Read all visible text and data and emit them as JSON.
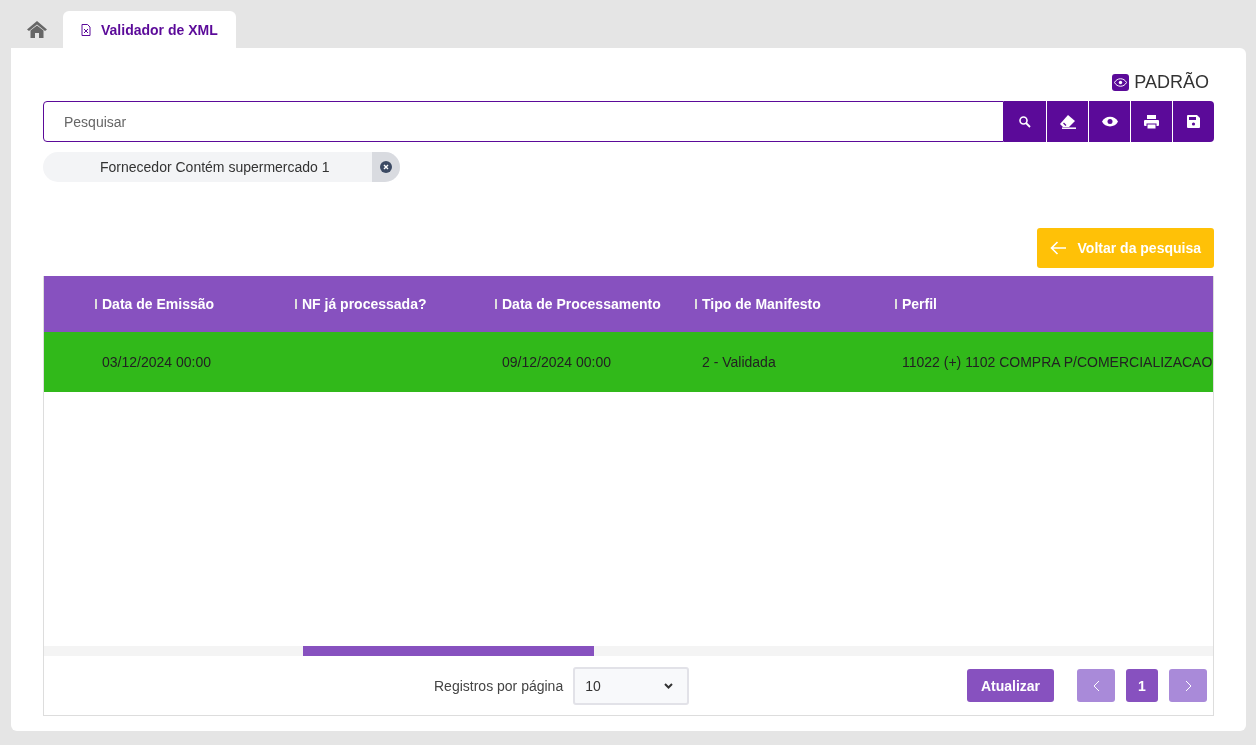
{
  "tabs": [
    {
      "kind": "home",
      "selected": false
    },
    {
      "kind": "page",
      "label": "Validador de XML",
      "selected": true
    }
  ],
  "view_badge": {
    "label": "PADRÃO"
  },
  "search": {
    "placeholder": "Pesquisar"
  },
  "toolbar": [
    {
      "kind": "search"
    },
    {
      "kind": "eraser"
    },
    {
      "kind": "eye"
    },
    {
      "kind": "print"
    },
    {
      "kind": "save"
    }
  ],
  "filter_chips": [
    {
      "label": "Fornecedor Contém supermercado 1"
    }
  ],
  "back_button": {
    "label": "Voltar da pesquisa"
  },
  "table": {
    "columns": [
      "Data de Emissão",
      "NF já processada?",
      "Data de Processamento",
      "Tipo de Manifesto",
      "Perfil"
    ],
    "rows": [
      {
        "color": "#31b91a",
        "cells": [
          "03/12/2024 00:00",
          "",
          "09/12/2024 00:00",
          "2 - Validada",
          "11022 (+) 1102 COMPRA P/COMERCIALIZACAO"
        ]
      }
    ]
  },
  "footer": {
    "page_size_label": "Registros por página",
    "page_size": "10",
    "refresh_button": "Atualizar",
    "prev_disabled": true,
    "next_disabled": true,
    "pages": [
      {
        "label": "1",
        "selected": true
      }
    ]
  }
}
